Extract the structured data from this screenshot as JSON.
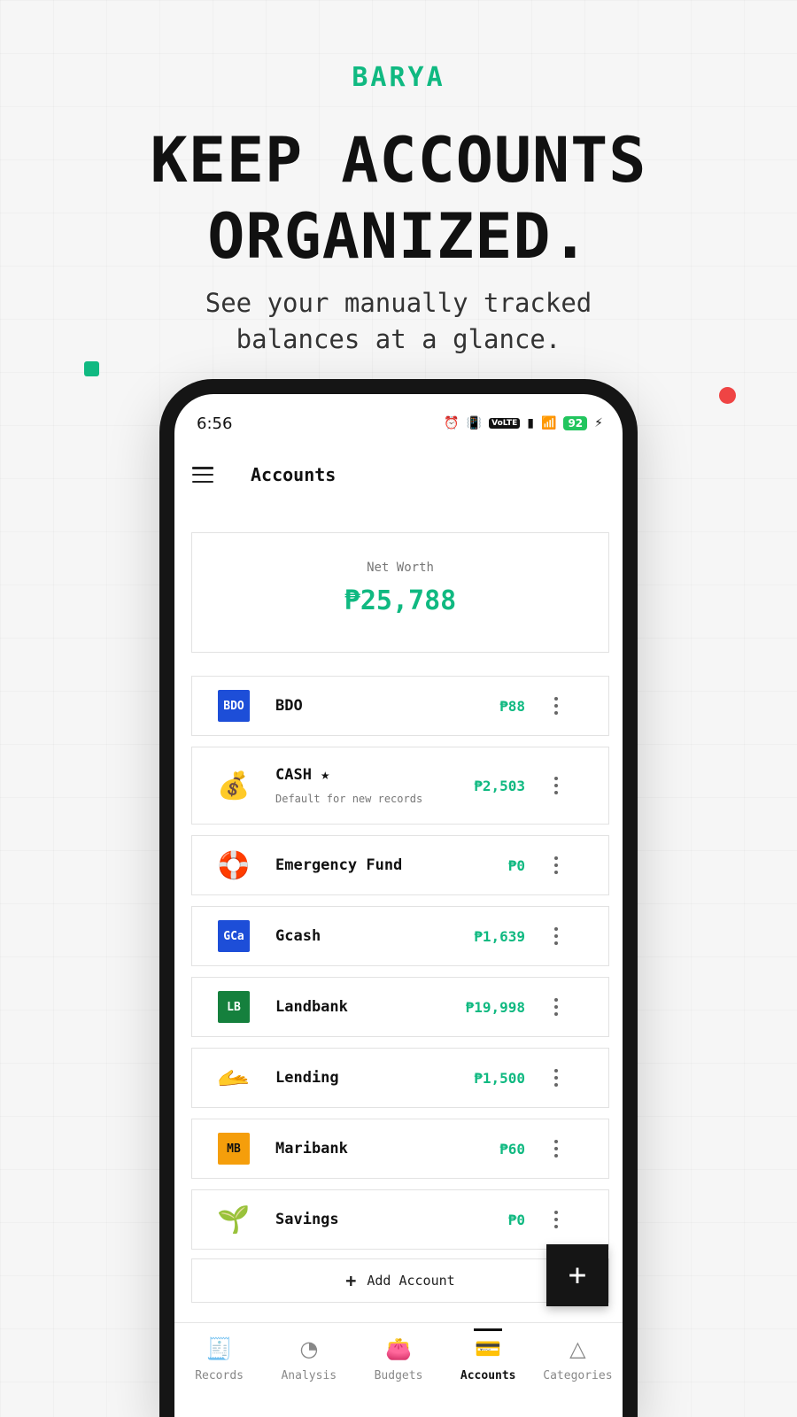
{
  "promo": {
    "brand": "BARYA",
    "headline_line1": "KEEP ACCOUNTS",
    "headline_line2": "ORGANIZED.",
    "subhead_line1": "See your manually tracked",
    "subhead_line2": "balances at a glance."
  },
  "status_bar": {
    "time": "6:56",
    "volte": "VoLTE",
    "battery": "92"
  },
  "app_bar": {
    "title": "Accounts"
  },
  "net_worth": {
    "label": "Net Worth",
    "value": "₱25,788"
  },
  "accounts": [
    {
      "name": "BDO",
      "amount": "₱88",
      "icon_text": "BDO",
      "icon": "bank-logo-icon",
      "icon_color": "#1d4ed8"
    },
    {
      "name": "CASH ★",
      "sub": "Default for new records",
      "amount": "₱2,503",
      "icon_text": "💰",
      "icon": "money-bag-icon"
    },
    {
      "name": "Emergency Fund",
      "amount": "₱0",
      "icon_text": "🛟",
      "icon": "life-ring-icon"
    },
    {
      "name": "Gcash",
      "amount": "₱1,639",
      "icon_text": "GCa",
      "icon": "wallet-logo-icon",
      "icon_color": "#1d4ed8"
    },
    {
      "name": "Landbank",
      "amount": "₱19,998",
      "icon_text": "LB",
      "icon": "bank-logo-icon",
      "icon_color": "#15803d"
    },
    {
      "name": "Lending",
      "amount": "₱1,500",
      "icon_text": "🫴",
      "icon": "open-hand-icon"
    },
    {
      "name": "Maribank",
      "amount": "₱60",
      "icon_text": "MB",
      "icon": "bank-logo-icon",
      "icon_color": "#f59e0b"
    },
    {
      "name": "Savings",
      "amount": "₱0",
      "icon_text": "🌱",
      "icon": "seedling-icon"
    }
  ],
  "add_account": {
    "label": "Add Account"
  },
  "bottom_nav": [
    {
      "label": "Records",
      "icon": "receipt-icon",
      "active": false
    },
    {
      "label": "Analysis",
      "icon": "pie-chart-icon",
      "active": false
    },
    {
      "label": "Budgets",
      "icon": "wallet-icon",
      "active": false
    },
    {
      "label": "Accounts",
      "icon": "card-wallet-icon",
      "active": true
    },
    {
      "label": "Categories",
      "icon": "shapes-icon",
      "active": false
    }
  ],
  "colors": {
    "accent": "#10b981",
    "dark": "#151515"
  }
}
